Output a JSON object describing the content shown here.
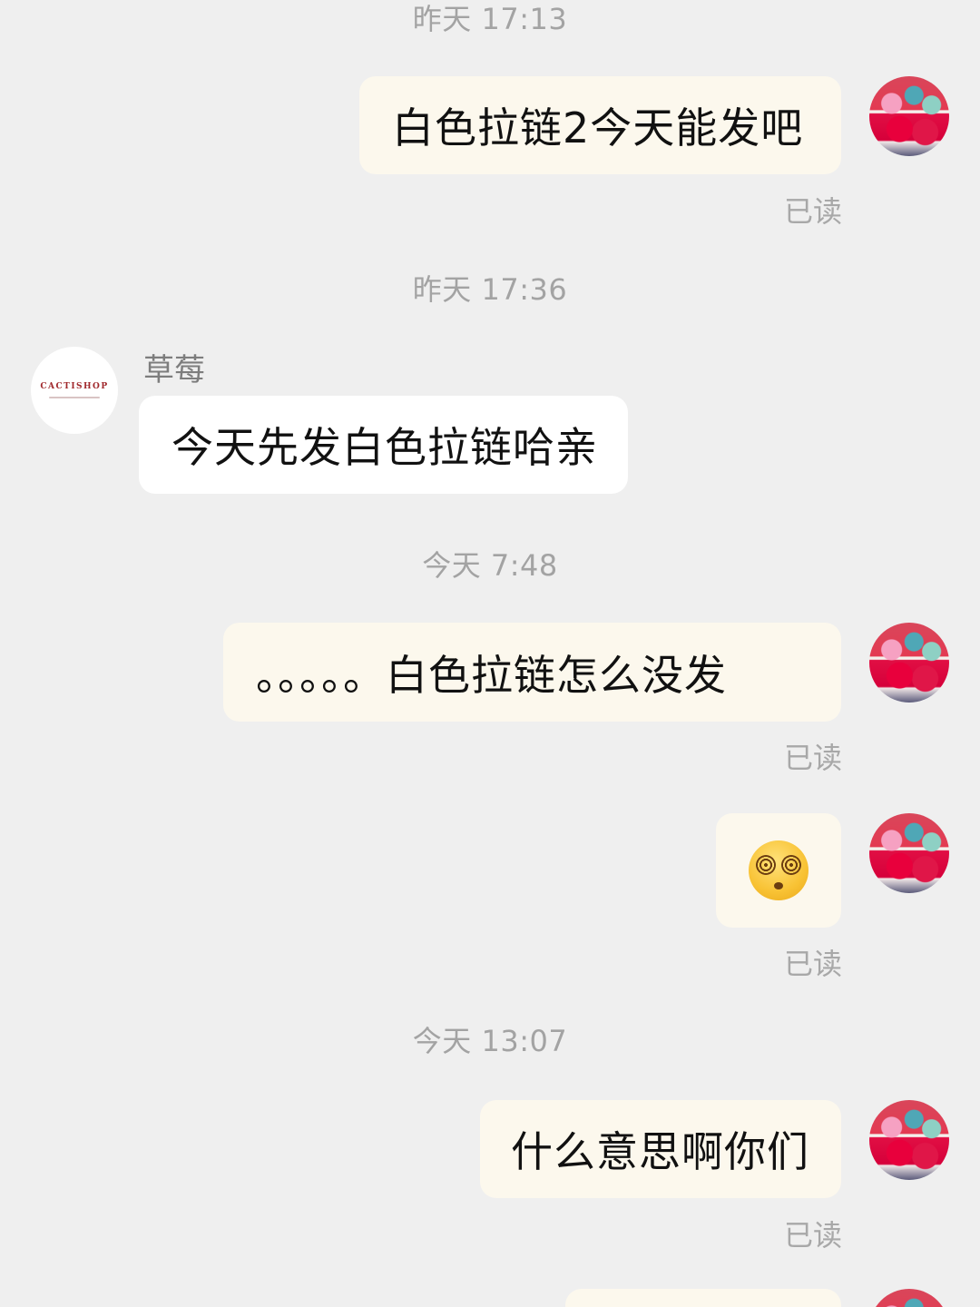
{
  "messages": {
    "ts1": "昨天 17:13",
    "msg1": "白色拉链2今天能发吧",
    "read1": "已读",
    "ts2": "昨天 17:36",
    "sender": "草莓",
    "shop_logo": "CACTISHOP",
    "msg2": "今天先发白色拉链哈亲",
    "ts3": "今天 7:48",
    "msg3": "。。。。。白色拉链怎么没发",
    "read3": "已读",
    "msg4_emoji": "dizzy-face-emoji",
    "read4": "已读",
    "ts5": "今天 13:07",
    "msg5": "什么意思啊你们",
    "read5": "已读"
  },
  "colors": {
    "background": "#efefef",
    "my_bubble": "#fcf8ed",
    "their_bubble": "#ffffff",
    "timestamp_text": "#a3a3a3"
  }
}
